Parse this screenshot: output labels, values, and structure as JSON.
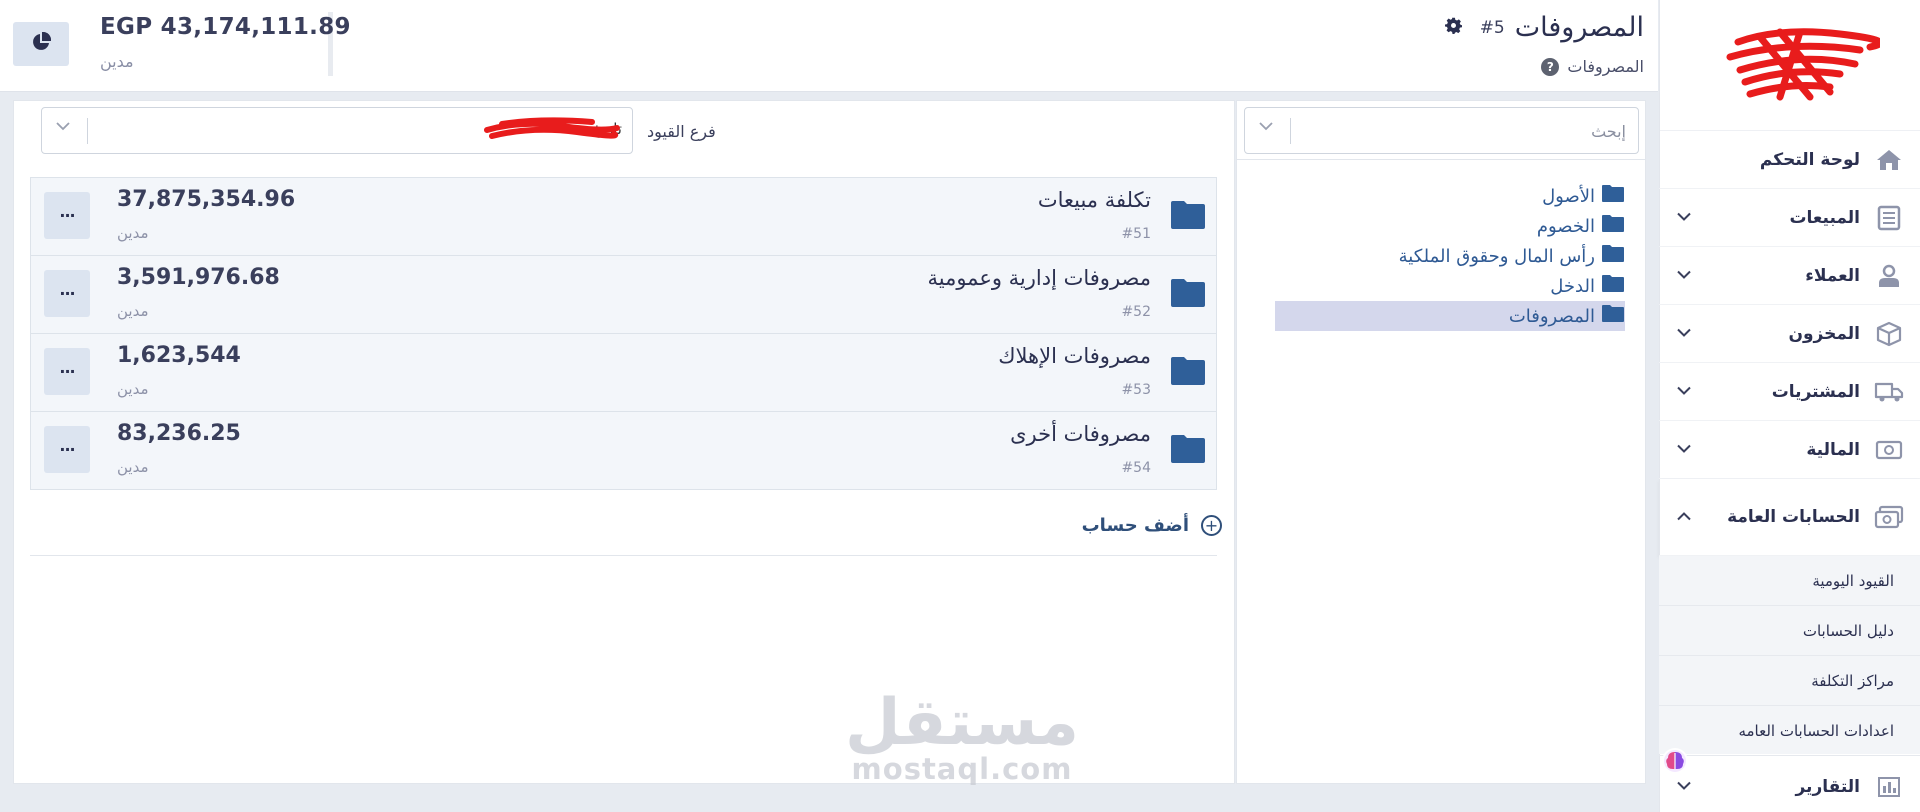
{
  "header": {
    "title": "المصروفات",
    "record_number": "#5",
    "breadcrumb": "المصروفات",
    "balance_amount": "EGP 43,174,111.89",
    "balance_type": "مدين"
  },
  "sidebar": {
    "items": [
      {
        "label": "لوحة التحكم",
        "icon": "home-icon"
      },
      {
        "label": "المبيعات",
        "icon": "invoice-icon"
      },
      {
        "label": "العملاء",
        "icon": "user-icon"
      },
      {
        "label": "المخزون",
        "icon": "box-icon"
      },
      {
        "label": "المشتريات",
        "icon": "truck-icon"
      },
      {
        "label": "المالية",
        "icon": "cash-icon"
      },
      {
        "label": "الحسابات العامة",
        "icon": "money-icon"
      }
    ],
    "sub_items": [
      "القيود اليومية",
      "دليل الحسابات",
      "مراكز التكلفة",
      "اعدادات الحسابات العامه"
    ],
    "bottom_item": {
      "label": "التقارير",
      "icon": "bar-chart-icon"
    }
  },
  "tree": {
    "search_placeholder": "إبحث",
    "items": [
      "الأصول",
      "الخصوم",
      "رأس المال وحقوق الملكية",
      "الدخل",
      "المصروفات"
    ],
    "selected_index": 4
  },
  "branch": {
    "label": "فرع القيود",
    "value": "تاريخ"
  },
  "accounts": [
    {
      "name": "تكلفة مبيعات",
      "code": "#51",
      "amount": "37,875,354.96",
      "type": "مدين"
    },
    {
      "name": "مصروفات إدارية وعمومية",
      "code": "#52",
      "amount": "3,591,976.68",
      "type": "مدين"
    },
    {
      "name": "مصروفات الإهلاك",
      "code": "#53",
      "amount": "1,623,544",
      "type": "مدين"
    },
    {
      "name": "مصروفات أخرى",
      "code": "#54",
      "amount": "83,236.25",
      "type": "مدين"
    }
  ],
  "add_account_label": "أضف حساب",
  "more_label": "···",
  "watermark": {
    "arabic": "مستقل",
    "english": "mostaql.com"
  },
  "colors": {
    "accent": "#2f5a94",
    "folder": "#2f5f99",
    "selected_bg": "#d4d7ec",
    "row_bg": "#f3f6fa",
    "logo_scribble": "#e81c1c"
  }
}
